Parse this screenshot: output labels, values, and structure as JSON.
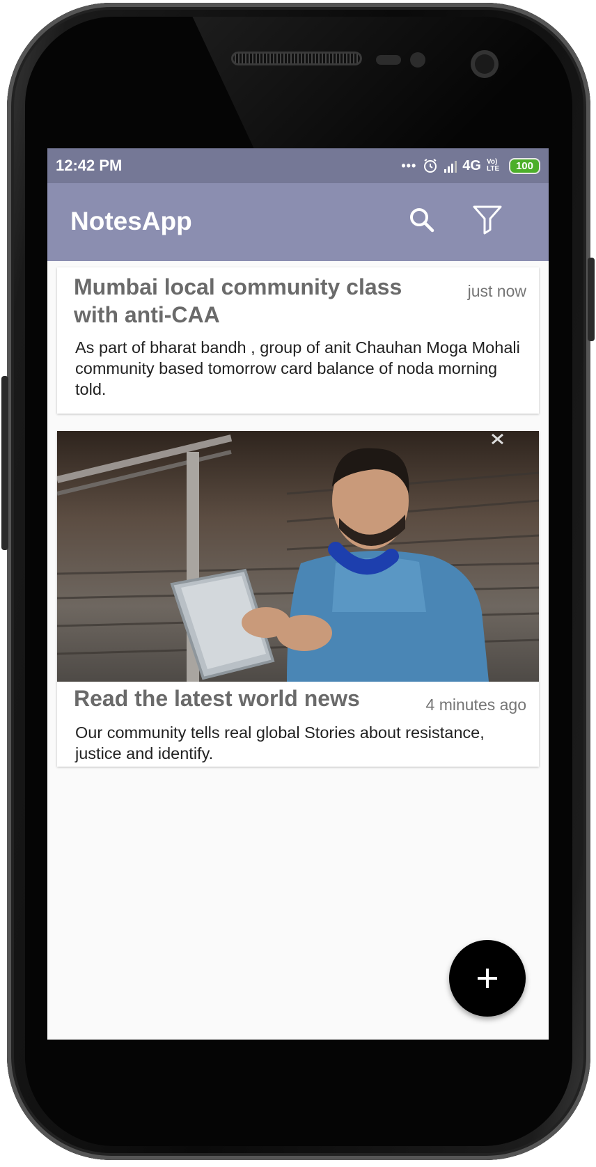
{
  "status_bar": {
    "time": "12:42 PM",
    "dots": "•••",
    "network": "4G",
    "volte": "Vo) LTE",
    "battery": "100"
  },
  "app_bar": {
    "title": "NotesApp",
    "search_icon": "search-icon",
    "filter_icon": "filter-icon"
  },
  "notes": [
    {
      "title_line1": "Mumbai local community class",
      "title_line2": "with anti-CAA",
      "time": "just now",
      "body": "As part of bharat bandh , group of anit Chauhan Moga Mohali community based tomorrow card balance of noda morning told."
    },
    {
      "title": "Read the latest world news",
      "time": "4 minutes ago",
      "body": "Our community tells real global Stories about resistance, justice and identify.",
      "image": "photo of man with headphones using a tablet on stairs"
    }
  ],
  "fab": {
    "icon": "plus-icon"
  },
  "colors": {
    "status_bar": "#757896",
    "app_bar": "#8b8eb0",
    "fab": "#000000",
    "battery": "#4caf2a"
  }
}
